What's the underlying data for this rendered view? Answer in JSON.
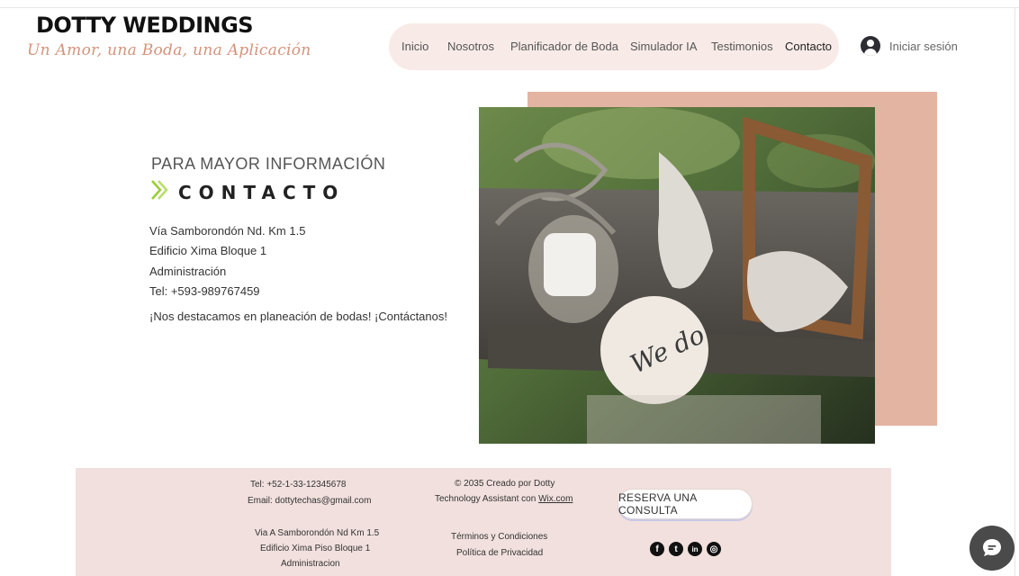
{
  "brand": {
    "title": "DOTTY WEDDINGS",
    "tagline": "Un Amor, una Boda, una Aplicación"
  },
  "nav": {
    "items": [
      {
        "label": "Inicio"
      },
      {
        "label": "Nosotros"
      },
      {
        "label": "Planificador de Boda"
      },
      {
        "label": "Simulador IA"
      },
      {
        "label": "Testimonios"
      },
      {
        "label": "Contacto"
      }
    ],
    "active": "Contacto",
    "login_label": "Iniciar sesión"
  },
  "contact": {
    "pre_title": "PARA MAYOR INFORMACIÓN",
    "title": "CONTACTO",
    "lines": [
      "Vía Samborondón Nd. Km 1.5",
      "Edificio Xima Bloque 1",
      "Administración",
      "Tel: +593-989767459"
    ],
    "tagline": "¡Nos destacamos en planeación de bodas! ¡Contáctanos!"
  },
  "image": {
    "plate_text": "We do"
  },
  "footer": {
    "phone": "Tel: +52-1-33-12345678",
    "email": "Email: dottytechas@gmail.com",
    "address": [
      "Via A Samborondón Nd Km 1.5",
      "Edificio Xima Piso Bloque 1",
      "Administracion"
    ],
    "copyright": "© 2035 Creado por Dotty",
    "credit_prefix": "Technology Assistant con ",
    "credit_link": "Wix.com",
    "terms": "Términos y Condiciones",
    "privacy": "Política de Privacidad",
    "cta": "RESERVA UNA CONSULTA",
    "social": [
      {
        "icon": "facebook-icon",
        "glyph": "f"
      },
      {
        "icon": "twitter-icon",
        "glyph": "t"
      },
      {
        "icon": "linkedin-icon",
        "glyph": "in"
      },
      {
        "icon": "instagram-icon",
        "glyph": "◎"
      }
    ]
  },
  "colors": {
    "accent_peach": "#e4b4a2",
    "nav_pill": "#f8ebe7",
    "footer_bg": "#f1e0dd",
    "chevron_green": "#9acd32",
    "chat_button": "#4a4a4a"
  }
}
